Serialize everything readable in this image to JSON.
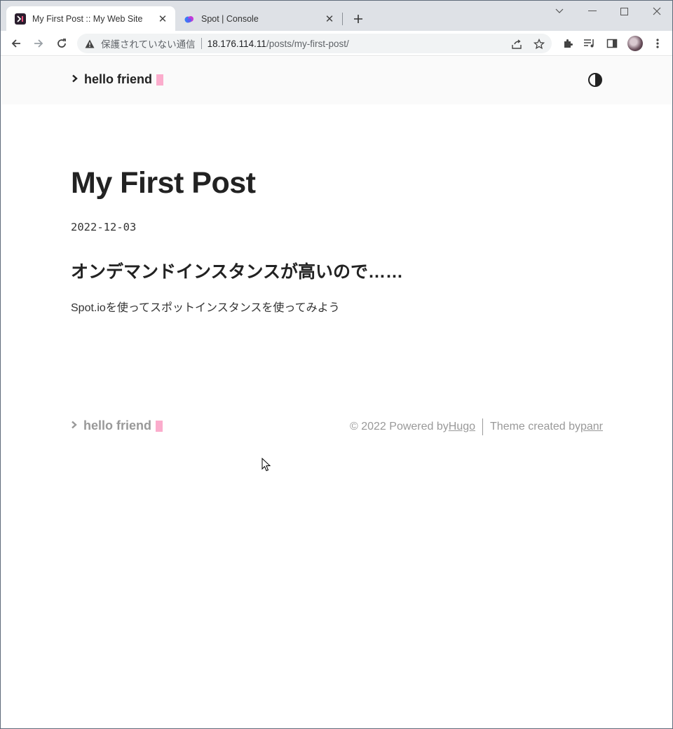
{
  "browser": {
    "tabs": [
      {
        "title": "My First Post :: My Web Site",
        "active": true,
        "favicon": "hugo-terminal-icon"
      },
      {
        "title": "Spot | Console",
        "active": false,
        "favicon": "spot-cloud-icon"
      }
    ],
    "close_glyph": "✕",
    "new_tab_glyph": "+",
    "address": {
      "security_label": "保護されていない通信",
      "host": "18.176.114.11",
      "path": "/posts/my-first-post/"
    }
  },
  "site": {
    "logo_text": "hello friend",
    "logo_mark": "›",
    "cursor_color": "#fbaccc"
  },
  "post": {
    "title": "My First Post",
    "date": "2022-12-03",
    "heading": "オンデマンドインスタンスが高いので……",
    "body": "Spot.ioを使ってスポットインスタンスを使ってみよう"
  },
  "footer": {
    "logo_text": "hello friend",
    "copyright_prefix": "© 2022 Powered by ",
    "hugo_link": "Hugo",
    "theme_prefix": "Theme created by ",
    "theme_link": "panr"
  }
}
